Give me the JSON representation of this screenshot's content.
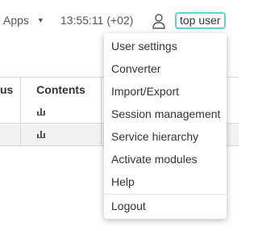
{
  "header": {
    "apps_label": "Apps",
    "clock": "13:55:11 (+02)",
    "user_button_label": "top user"
  },
  "grid": {
    "columns": [
      "us",
      "Contents"
    ],
    "rows": 2
  },
  "user_menu": {
    "items": [
      "User settings",
      "Converter",
      "Import/Export",
      "Session management",
      "Service hierarchy",
      "Activate modules",
      "Help"
    ],
    "logout_label": "Logout"
  },
  "colors": {
    "accent": "#5fd3d9",
    "text": "#333333",
    "icon": "#555555",
    "grid_line": "#d9d9d9"
  }
}
